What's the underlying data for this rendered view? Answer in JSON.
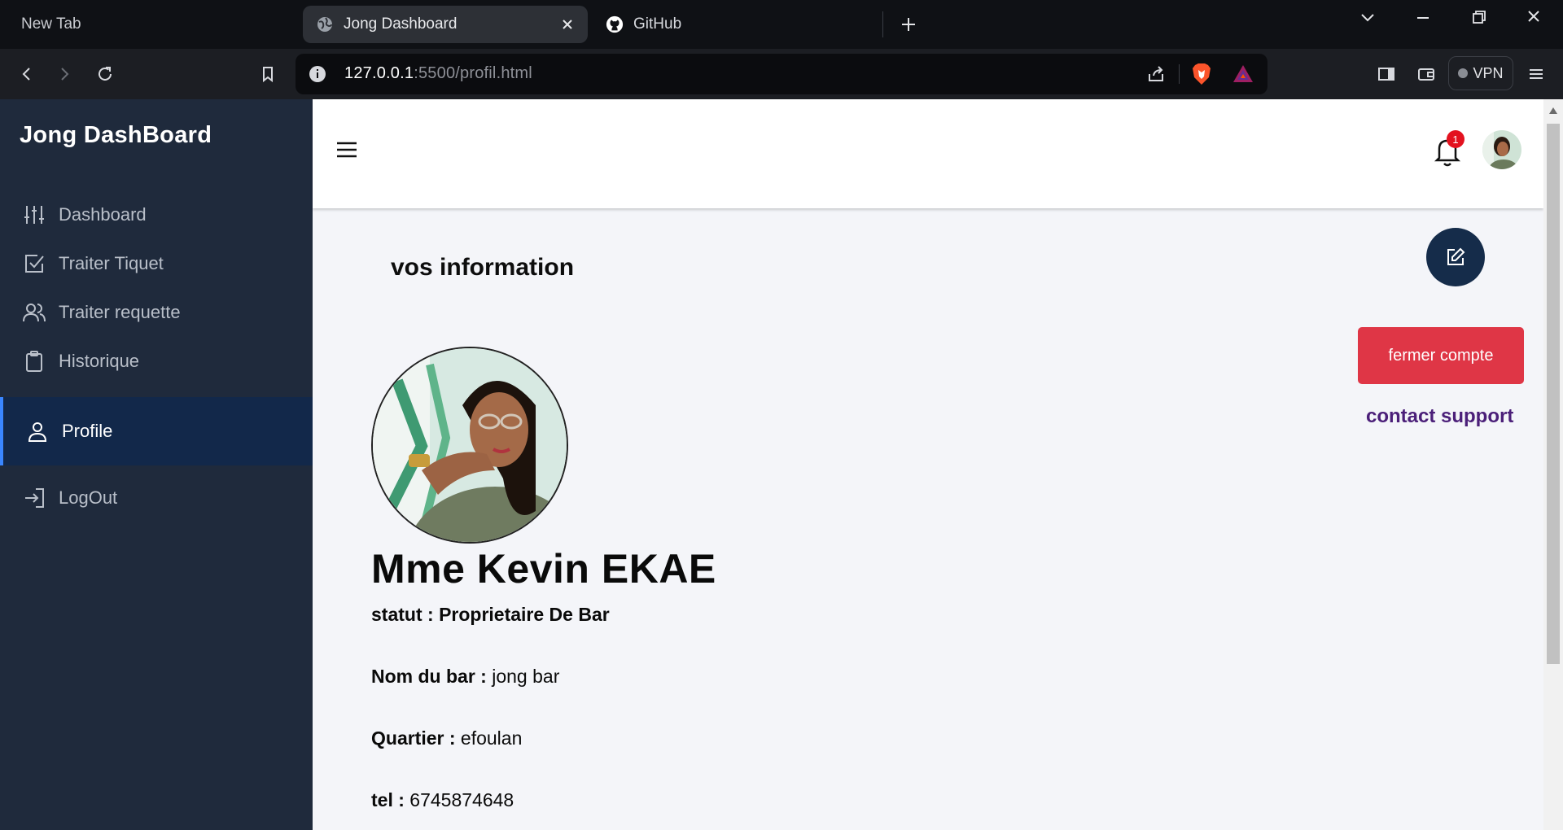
{
  "browser": {
    "tabs": [
      {
        "label": "New Tab"
      },
      {
        "label": "Jong Dashboard"
      },
      {
        "label": "GitHub"
      }
    ],
    "url_host": "127.0.0.1",
    "url_rest": ":5500/profil.html",
    "vpn_label": "VPN"
  },
  "sidebar": {
    "brand": "Jong DashBoard",
    "items": [
      {
        "label": "Dashboard",
        "icon": "sliders-icon"
      },
      {
        "label": "Traiter Tiquet",
        "icon": "checkbox-icon"
      },
      {
        "label": "Traiter requette",
        "icon": "users-icon"
      },
      {
        "label": "Historique",
        "icon": "clipboard-icon"
      },
      {
        "label": "Profile",
        "icon": "user-icon",
        "active": true
      },
      {
        "label": "LogOut",
        "icon": "logout-icon"
      }
    ]
  },
  "header": {
    "notification_count": "1"
  },
  "profile": {
    "section_title": "vos information",
    "name": "Mme Kevin EKAE",
    "statut_label": "statut : ",
    "statut_value": "Proprietaire De Bar",
    "bar_label": "Nom du bar : ",
    "bar_value": "jong bar",
    "quartier_label": "Quartier : ",
    "quartier_value": "efoulan",
    "tel_label": "tel : ",
    "tel_value": "6745874648"
  },
  "actions": {
    "close_account": "fermer compte",
    "contact_support": "contact support"
  },
  "colors": {
    "sidebar_bg": "#1f2a3c",
    "active_nav_bg": "#12284a",
    "danger": "#df3646",
    "fab_bg": "#152c4a",
    "support_link": "#4b1f79"
  }
}
